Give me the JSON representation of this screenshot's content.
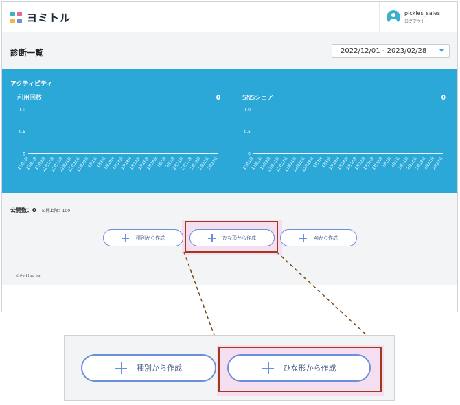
{
  "header": {
    "logo_text": "ヨミトル",
    "user_name": "pickles_sales",
    "logout_label": "ログアウト"
  },
  "page": {
    "title": "診断一覧",
    "date_range": "2022/12/01 - 2023/02/28"
  },
  "activity": {
    "section_title": "アクティビティ",
    "charts": [
      {
        "title": "利用回数",
        "total": "0",
        "y_ticks": [
          "1.0",
          "0.5",
          "0"
        ],
        "x_ticks": [
          "12月1日",
          "12月5日",
          "12月9日",
          "12月13日",
          "12月17日",
          "12月21日",
          "12月25日",
          "12月29日",
          "1月2日",
          "1月6日",
          "1月10日",
          "1月14日",
          "1月18日",
          "1月22日",
          "1月26日",
          "1月30日",
          "2月3日",
          "2月7日",
          "2月11日",
          "2月15日",
          "2月19日",
          "2月23日",
          "2月27日"
        ]
      },
      {
        "title": "SNSシェア",
        "total": "0",
        "y_ticks": [
          "1.0",
          "0.5",
          "0"
        ],
        "x_ticks": [
          "12月1日",
          "12月5日",
          "12月9日",
          "12月13日",
          "12月17日",
          "12月21日",
          "12月25日",
          "12月29日",
          "1月2日",
          "1月6日",
          "1月10日",
          "1月14日",
          "1月18日",
          "1月22日",
          "1月26日",
          "1月30日",
          "2月3日",
          "2月7日",
          "2月11日",
          "2月15日",
          "2月19日",
          "2月23日",
          "2月27日"
        ]
      }
    ]
  },
  "chart_data": [
    {
      "type": "line",
      "title": "利用回数",
      "x": [
        "12月1日",
        "12月5日",
        "12月9日",
        "12月13日",
        "12月17日",
        "12月21日",
        "12月25日",
        "12月29日",
        "1月2日",
        "1月6日",
        "1月10日",
        "1月14日",
        "1月18日",
        "1月22日",
        "1月26日",
        "1月30日",
        "2月3日",
        "2月7日",
        "2月11日",
        "2月15日",
        "2月19日",
        "2月23日",
        "2月27日"
      ],
      "values": [
        0,
        0,
        0,
        0,
        0,
        0,
        0,
        0,
        0,
        0,
        0,
        0,
        0,
        0,
        0,
        0,
        0,
        0,
        0,
        0,
        0,
        0,
        0
      ],
      "ylim": [
        0,
        1.0
      ]
    },
    {
      "type": "line",
      "title": "SNSシェア",
      "x": [
        "12月1日",
        "12月5日",
        "12月9日",
        "12月13日",
        "12月17日",
        "12月21日",
        "12月25日",
        "12月29日",
        "1月2日",
        "1月6日",
        "1月10日",
        "1月14日",
        "1月18日",
        "1月22日",
        "1月26日",
        "1月30日",
        "2月3日",
        "2月7日",
        "2月11日",
        "2月15日",
        "2月19日",
        "2月23日",
        "2月27日"
      ],
      "values": [
        0,
        0,
        0,
        0,
        0,
        0,
        0,
        0,
        0,
        0,
        0,
        0,
        0,
        0,
        0,
        0,
        0,
        0,
        0,
        0,
        0,
        0,
        0
      ],
      "ylim": [
        0,
        1.0
      ]
    }
  ],
  "stats": {
    "published_count": "公開数：0",
    "published_limit": "公開上限：100"
  },
  "actions": {
    "by_type": "種別から作成",
    "from_template": "ひな形から作成",
    "with_ai": "AIから作成"
  },
  "footer": {
    "copyright": "©Pickles Inc."
  },
  "colors": {
    "accent_blue": "#2ba8d8",
    "button_border": "#6b8fd9",
    "highlight_border": "#a03a1c"
  }
}
